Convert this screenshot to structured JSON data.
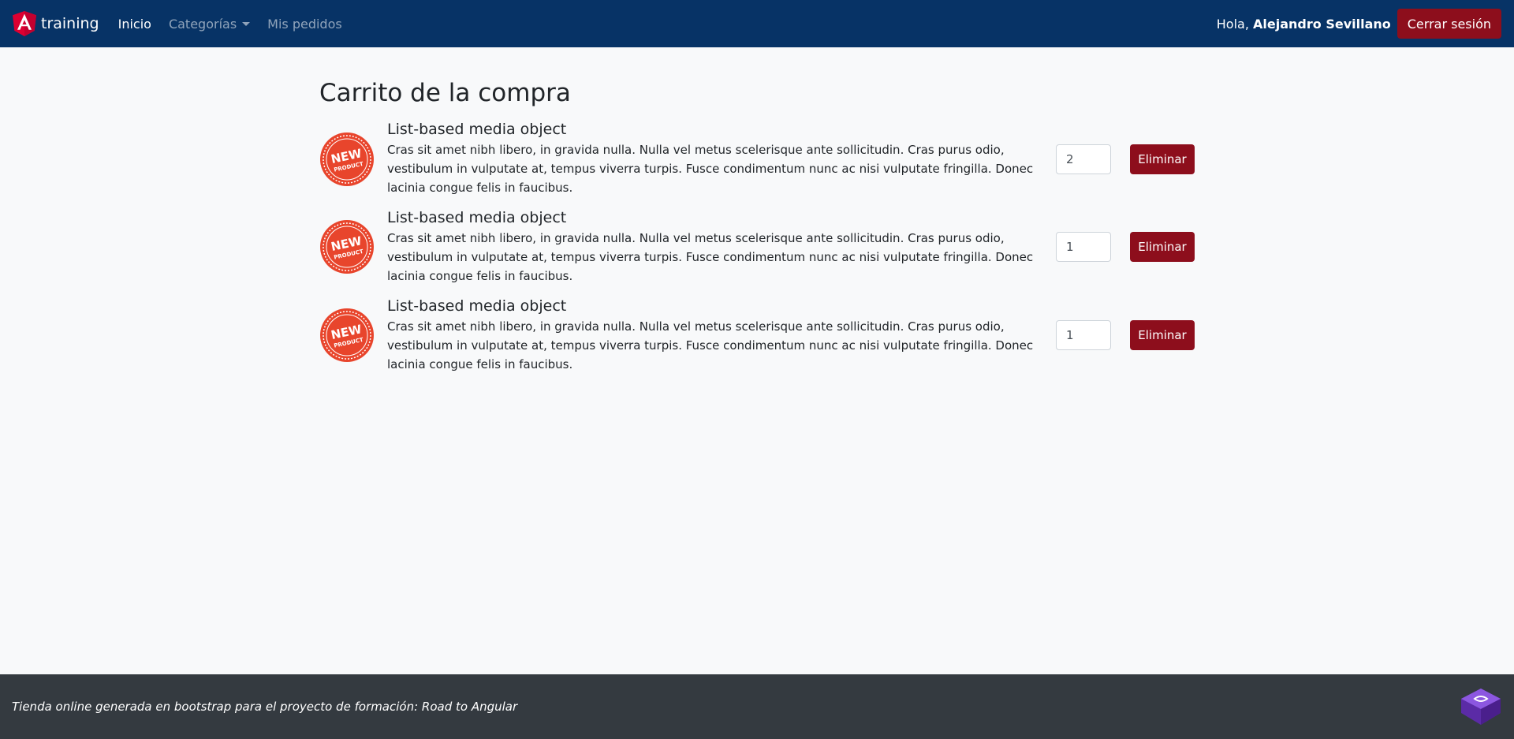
{
  "navbar": {
    "brand": "training",
    "links": [
      {
        "label": "Inicio",
        "active": true
      },
      {
        "label": "Categorías",
        "active": false,
        "dropdown": true
      },
      {
        "label": "Mis pedidos",
        "active": false
      }
    ],
    "greeting_prefix": "Hola,",
    "user_name": "Alejandro Sevillano",
    "logout_label": "Cerrar sesión"
  },
  "cart": {
    "title": "Carrito de la compra",
    "items": [
      {
        "title": "List-based media object",
        "description": "Cras sit amet nibh libero, in gravida nulla. Nulla vel metus scelerisque ante sollicitudin. Cras purus odio, vestibulum in vulputate at, tempus viverra turpis. Fusce condimentum nunc ac nisi vulputate fringilla. Donec lacinia congue felis in faucibus.",
        "quantity": "2",
        "delete_label": "Eliminar",
        "badge_text": "NEW PRODUCT"
      },
      {
        "title": "List-based media object",
        "description": "Cras sit amet nibh libero, in gravida nulla. Nulla vel metus scelerisque ante sollicitudin. Cras purus odio, vestibulum in vulputate at, tempus viverra turpis. Fusce condimentum nunc ac nisi vulputate fringilla. Donec lacinia congue felis in faucibus.",
        "quantity": "1",
        "delete_label": "Eliminar",
        "badge_text": "NEW PRODUCT"
      },
      {
        "title": "List-based media object",
        "description": "Cras sit amet nibh libero, in gravida nulla. Nulla vel metus scelerisque ante sollicitudin. Cras purus odio, vestibulum in vulputate at, tempus viverra turpis. Fusce condimentum nunc ac nisi vulputate fringilla. Donec lacinia congue felis in faucibus.",
        "quantity": "1",
        "delete_label": "Eliminar",
        "badge_text": "NEW PRODUCT"
      }
    ]
  },
  "footer": {
    "text": "Tienda online generada en bootstrap para el proyecto de formación: Road to Angular"
  },
  "colors": {
    "navbar_bg": "#073366",
    "danger": "#8d0e1c",
    "footer_bg": "#343a40",
    "page_bg": "#f8f9fa"
  },
  "icons": [
    "angular-logo-icon",
    "dropdown-caret-icon",
    "new-product-badge-icon",
    "bootstrap-logo-icon"
  ]
}
